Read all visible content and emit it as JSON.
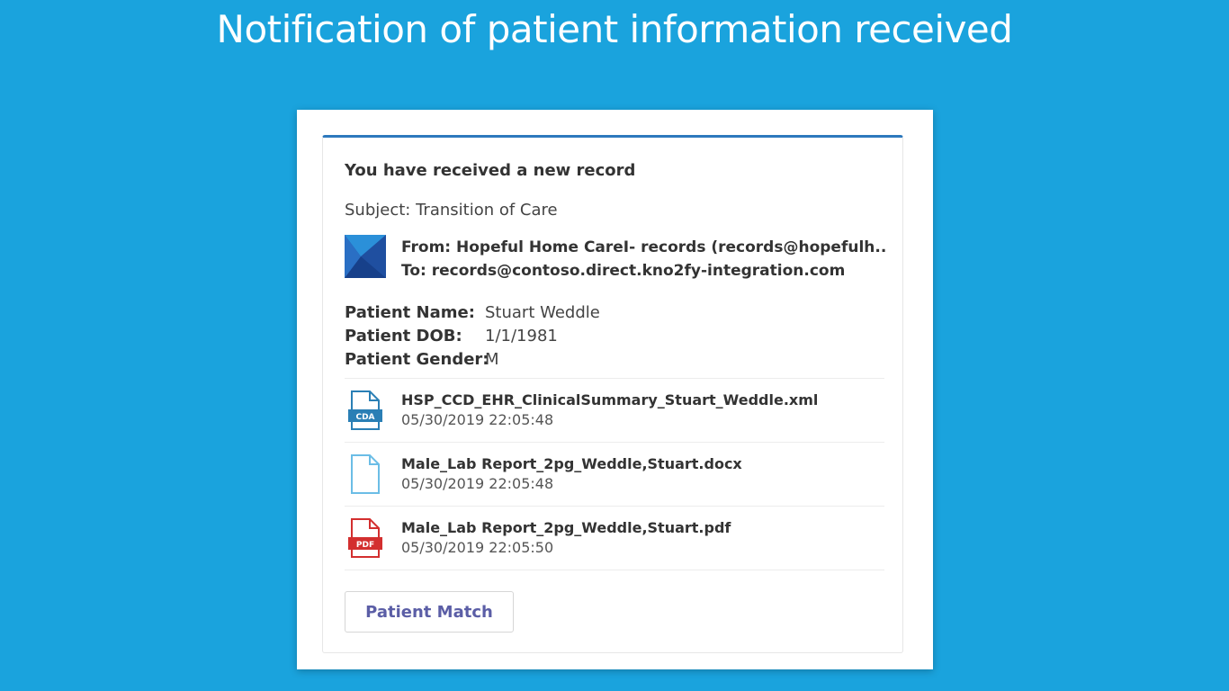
{
  "headline": "Notification of patient information received",
  "card": {
    "title": "You have received a new record",
    "subject": "Subject: Transition of Care",
    "from": "From: Hopeful Home CareI- records (records@hopefulh...",
    "to": "To: records@contoso.direct.kno2fy-integration.com",
    "logo_icon": "kno2-logo-icon",
    "accent_color": "#2d79bd"
  },
  "patient": {
    "name_label": "Patient Name:",
    "name_value": "Stuart Weddle",
    "dob_label": "Patient DOB:",
    "dob_value": "1/1/1981",
    "gender_label": "Patient Gender:",
    "gender_value": "M"
  },
  "files": [
    {
      "icon": "cda-file-icon",
      "name": "HSP_CCD_EHR_ClinicalSummary_Stuart_Weddle.xml",
      "date": "05/30/2019 22:05:48"
    },
    {
      "icon": "document-file-icon",
      "name": "Male_Lab Report_2pg_Weddle,Stuart.docx",
      "date": "05/30/2019 22:05:48"
    },
    {
      "icon": "pdf-file-icon",
      "name": "Male_Lab Report_2pg_Weddle,Stuart.pdf",
      "date": "05/30/2019 22:05:50"
    }
  ],
  "actions": {
    "patient_match_label": "Patient Match"
  },
  "colors": {
    "background": "#1aa3dd",
    "button_text": "#5b5ea6",
    "pdf_red": "#d32f2f",
    "cda_blue": "#2a7fb5"
  }
}
